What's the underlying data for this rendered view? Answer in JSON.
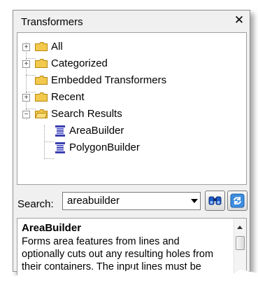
{
  "panel": {
    "title": "Transformers",
    "close_icon": "close-icon"
  },
  "tree": {
    "items": [
      {
        "label": "All",
        "expander": "+",
        "icon": "folder-icon"
      },
      {
        "label": "Categorized",
        "expander": "+",
        "icon": "folder-icon"
      },
      {
        "label": "Embedded Transformers",
        "expander": "",
        "icon": "folder-icon"
      },
      {
        "label": "Recent",
        "expander": "+",
        "icon": "folder-icon"
      },
      {
        "label": "Search Results",
        "expander": "−",
        "icon": "folder-icon"
      }
    ],
    "children": [
      {
        "label": "AreaBuilder",
        "icon": "transformer-icon"
      },
      {
        "label": "PolygonBuilder",
        "icon": "transformer-icon"
      }
    ]
  },
  "search": {
    "label": "Search:",
    "value": "areabuilder",
    "find_icon": "binoculars-icon",
    "refresh_icon": "refresh-icon"
  },
  "description": {
    "title": "AreaBuilder",
    "body": "Forms area features from lines and optionally cuts out any resulting holes from their containers. The input lines must be topologically correct and"
  },
  "colors": {
    "folder": "#f2c94c",
    "folder_edge": "#b8860b",
    "transformer": "#3a3fb0",
    "panel_bg": "#f0f0f0"
  }
}
